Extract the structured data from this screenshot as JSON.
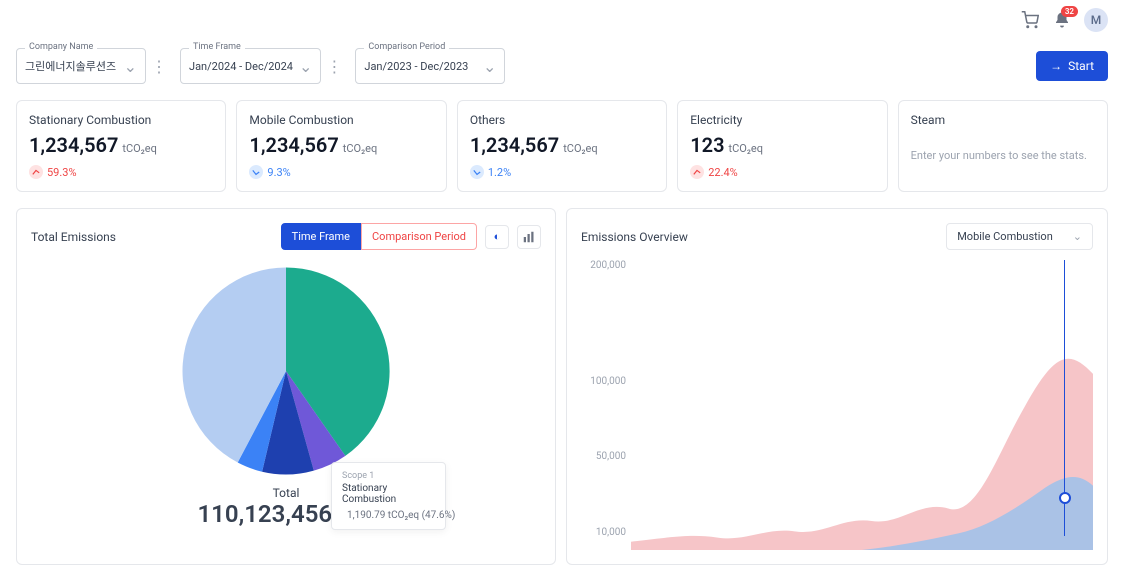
{
  "header": {
    "notification_count": "32",
    "avatar_initial": "M"
  },
  "filters": {
    "company": {
      "label": "Company Name",
      "value": "그린에너지솔루션즈"
    },
    "timeframe": {
      "label": "Time Frame",
      "value": "Jan/2024 - Dec/2024"
    },
    "comparison": {
      "label": "Comparison Period",
      "value": "Jan/2023 - Dec/2023"
    }
  },
  "actions": {
    "start": "Start"
  },
  "cards": [
    {
      "title": "Stationary Combustion",
      "value": "1,234,567",
      "unit": "tCO₂eq",
      "trend": {
        "dir": "up",
        "value": "59.3%"
      }
    },
    {
      "title": "Mobile Combustion",
      "value": "1,234,567",
      "unit": "tCO₂eq",
      "trend": {
        "dir": "down",
        "value": "9.3%"
      }
    },
    {
      "title": "Others",
      "value": "1,234,567",
      "unit": "tCO₂eq",
      "trend": {
        "dir": "down",
        "value": "1.2%"
      }
    },
    {
      "title": "Electricity",
      "value": "123",
      "unit": "tCO₂eq",
      "trend": {
        "dir": "up",
        "value": "22.4%"
      }
    },
    {
      "title": "Steam",
      "empty_text": "Enter your numbers to see the stats."
    }
  ],
  "total_emissions": {
    "title": "Total Emissions",
    "toggles": {
      "timeframe": "Time Frame",
      "comparison": "Comparison Period"
    },
    "total_label": "Total",
    "total_value": "110,123,456",
    "total_unit": "tCO₂eq",
    "tooltip": {
      "scope": "Scope 1",
      "category": "Stationary Combustion",
      "value": "1,190.79 tCO₂eq (47.6%)"
    }
  },
  "overview": {
    "title": "Emissions Overview",
    "selected": "Mobile Combustion",
    "yticks": [
      "200,000",
      "100,000",
      "50,000",
      "10,000"
    ]
  },
  "chart_data": [
    {
      "type": "pie",
      "title": "Total Emissions",
      "series": [
        {
          "name": "Segment A (teal)",
          "value": 40,
          "color": "#14b8a6"
        },
        {
          "name": "Segment B (violet)",
          "value": 5,
          "color": "#6f58d8"
        },
        {
          "name": "Stationary Combustion (deep blue)",
          "value": 8,
          "color": "#1e40af"
        },
        {
          "name": "Segment D (blue)",
          "value": 4,
          "color": "#3b82f6"
        },
        {
          "name": "Segment E (light blue)",
          "value": 43,
          "color": "#b4cdf2"
        }
      ],
      "total": "110,123,456 tCO₂eq"
    },
    {
      "type": "area",
      "title": "Emissions Overview",
      "xlabel": "",
      "ylabel": "",
      "ylim": [
        0,
        200000
      ],
      "yticks": [
        10000,
        50000,
        100000,
        200000
      ],
      "series": [
        {
          "name": "Series A (red)",
          "color": "#f6c5c8",
          "values": [
            8000,
            11000,
            9000,
            14000,
            12000,
            20000,
            16000,
            28000,
            22000,
            55000,
            110000,
            96000
          ]
        },
        {
          "name": "Series B (blue)",
          "color": "#aac2e6",
          "values": [
            0,
            0,
            0,
            0,
            0,
            0,
            0,
            0,
            6000,
            12000,
            25000,
            40000
          ]
        }
      ]
    }
  ]
}
